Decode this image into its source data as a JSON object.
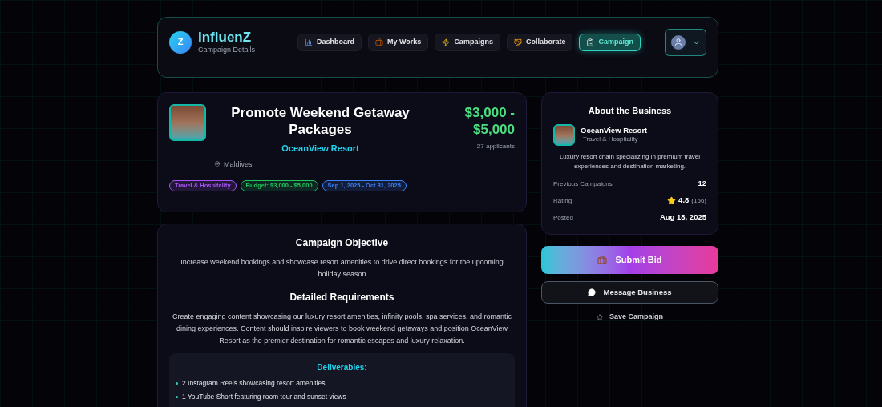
{
  "header": {
    "logo_letter": "Z",
    "brand": "InfluenZ",
    "subtitle": "Campaign Details",
    "nav": [
      {
        "label": "Dashboard",
        "selected": false
      },
      {
        "label": "My Works",
        "selected": false
      },
      {
        "label": "Campaigns",
        "selected": false
      },
      {
        "label": "Collaborate",
        "selected": false
      },
      {
        "label": "Campaign",
        "selected": true
      }
    ]
  },
  "campaign": {
    "title": "Promote Weekend Getaway Packages",
    "business": "OceanView Resort",
    "budget": "$3,000 - $5,000",
    "applicants": "27 applicants",
    "location": "Maldives",
    "tags": [
      {
        "label": "Travel & Hospitality",
        "color": "#a855f7"
      },
      {
        "label": "Budget: $3,000 - $5,000",
        "color": "#22c55e"
      },
      {
        "label": "Sep 1, 2025 - Oct 31, 2025",
        "color": "#3b82f6"
      }
    ]
  },
  "details": {
    "objective_title": "Campaign Objective",
    "objective": "Increase weekend bookings and showcase resort amenities to drive direct bookings for the upcoming holiday season",
    "requirements_title": "Detailed Requirements",
    "requirements": "Create engaging content showcasing our luxury resort amenities, infinity pools, spa services, and romantic dining experiences. Content should inspire viewers to book weekend getaways and position OceanView Resort as the premier destination for romantic escapes and luxury relaxation.",
    "deliverables_title": "Deliverables:",
    "deliverables": [
      "2 Instagram Reels showcasing resort amenities",
      "1 YouTube Short featuring room tour and sunset views"
    ]
  },
  "business": {
    "title": "About the Business",
    "name": "OceanView Resort",
    "category": "Travel & Hospitality",
    "description": "Luxury resort chain specializing in premium travel experiences and destination marketing.",
    "stats": [
      {
        "label": "Previous Campaigns",
        "value": "12",
        "kind": "plain"
      },
      {
        "label": "Rating",
        "value": "4.8",
        "count": "(156)",
        "kind": "rating"
      },
      {
        "label": "Posted",
        "value": "Aug 18, 2025",
        "kind": "plain"
      }
    ]
  },
  "actions": {
    "submit": "Submit Bid",
    "message": "Message Business",
    "save": "Save Campaign"
  }
}
